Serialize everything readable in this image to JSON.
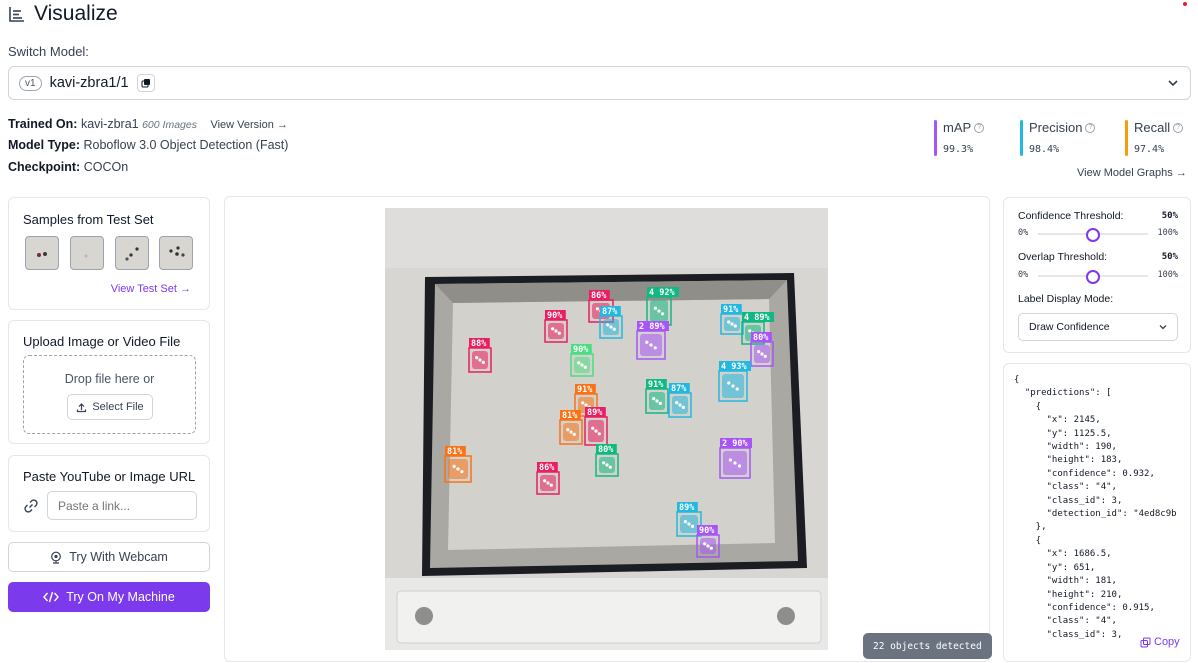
{
  "page": {
    "title": "Visualize"
  },
  "model": {
    "switch_label": "Switch Model:",
    "version": "v1",
    "name": "kavi-zbra1/1"
  },
  "info": {
    "trained_on_label": "Trained On:",
    "trained_on_value": "kavi-zbra1",
    "image_count": "600 Images",
    "view_version": "View Version →",
    "model_type_label": "Model Type:",
    "model_type_value": "Roboflow 3.0 Object Detection (Fast)",
    "checkpoint_label": "Checkpoint:",
    "checkpoint_value": "COCOn"
  },
  "metrics": [
    {
      "name": "mAP",
      "value": "99.3%",
      "color": "#a855f7"
    },
    {
      "name": "Precision",
      "value": "98.4%",
      "color": "#22b8e0"
    },
    {
      "name": "Recall",
      "value": "97.4%",
      "color": "#f59e0b"
    }
  ],
  "view_graphs": "View Model Graphs →",
  "samples": {
    "title": "Samples from Test Set",
    "link": "View Test Set →"
  },
  "upload": {
    "title": "Upload Image or Video File",
    "drop_text": "Drop file here or",
    "button": "Select File"
  },
  "paste": {
    "title": "Paste YouTube or Image URL",
    "placeholder": "Paste a link..."
  },
  "webcam_button": "Try With Webcam",
  "machine_button": "Try On My Machine",
  "detected_badge": "22 objects detected",
  "settings": {
    "confidence_label": "Confidence Threshold:",
    "confidence_value": "50%",
    "confidence_level": 0.5,
    "overlap_label": "Overlap Threshold:",
    "overlap_value": "50%",
    "overlap_level": 0.5,
    "slider_min": "0%",
    "slider_max": "100%",
    "mode_label": "Label Display Mode:",
    "mode_value": "Draw Confidence"
  },
  "json_output": "{\n  \"predictions\": [\n    {\n      \"x\": 2145,\n      \"y\": 1125.5,\n      \"width\": 190,\n      \"height\": 183,\n      \"confidence\": 0.932,\n      \"class\": \"4\",\n      \"class_id\": 3,\n      \"detection_id\": \"4ed8c9b\n    },\n    {\n      \"x\": 1686.5,\n      \"y\": 651,\n      \"width\": 181,\n      \"height\": 210,\n      \"confidence\": 0.915,\n      \"class\": \"4\",\n      \"class_id\": 3,",
  "copy_label": "Copy",
  "detections": [
    {
      "label": "90%",
      "color": "#e91e63"
    },
    {
      "label": "86%",
      "color": "#e91e63"
    },
    {
      "label": "87%",
      "color": "#22b8e0"
    },
    {
      "label": "4 92%",
      "color": "#10b981"
    },
    {
      "label": "2 89%",
      "color": "#a855f7"
    },
    {
      "label": "91%",
      "color": "#22b8e0"
    },
    {
      "label": "4 89%",
      "color": "#10b981"
    },
    {
      "label": "80%",
      "color": "#a855f7"
    },
    {
      "label": "88%",
      "color": "#e91e63"
    },
    {
      "label": "90%",
      "color": "#4ade80"
    },
    {
      "label": "4 93%",
      "color": "#22b8e0"
    },
    {
      "label": "91%",
      "color": "#10b981"
    },
    {
      "label": "87%",
      "color": "#22b8e0"
    },
    {
      "label": "91%",
      "color": "#f97316"
    },
    {
      "label": "81%",
      "color": "#f97316"
    },
    {
      "label": "89%",
      "color": "#e91e63"
    },
    {
      "label": "80%",
      "color": "#10b981"
    },
    {
      "label": "2 90%",
      "color": "#a855f7"
    },
    {
      "label": "81%",
      "color": "#f97316"
    },
    {
      "label": "86%",
      "color": "#e91e63"
    },
    {
      "label": "89%",
      "color": "#22b8e0"
    },
    {
      "label": "90%",
      "color": "#a855f7"
    }
  ]
}
